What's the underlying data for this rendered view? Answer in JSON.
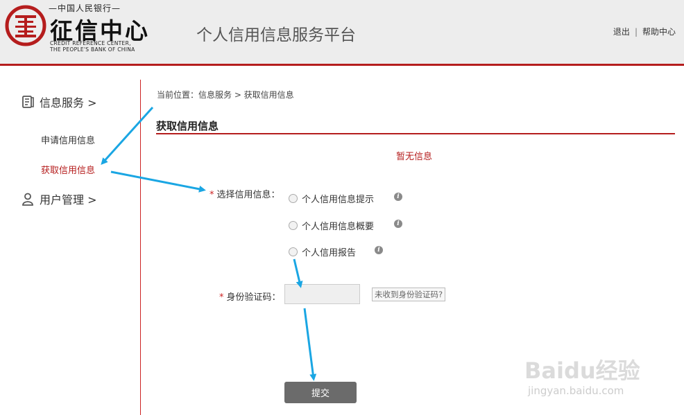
{
  "header": {
    "logo_top_text": "—中国人民银行—",
    "logo_main_text": "征信中心",
    "logo_en_line1": "CREDIT REFERENCE CENTER,",
    "logo_en_line2": "THE PEOPLE'S BANK OF CHINA",
    "platform_title": "个人信用信息服务平台",
    "logout_label": "退出",
    "link_separator": "|",
    "help_label": "帮助中心",
    "brand_color": "#b51d1d"
  },
  "sidebar": {
    "groups": [
      {
        "label": "信息服务 >",
        "icon": "document-icon"
      },
      {
        "label": "用户管理 >",
        "icon": "user-icon"
      }
    ],
    "items": [
      {
        "label": "申请信用信息",
        "active": false
      },
      {
        "label": "获取信用信息",
        "active": true
      }
    ]
  },
  "main": {
    "breadcrumb": "当前位置：信息服务 > 获取信用信息",
    "section_title": "获取信用信息",
    "notice": "暂无信息",
    "required_mark": "*",
    "select_label": "选择信用信息：",
    "options": [
      {
        "label": "个人信用信息提示",
        "info_icon": "info-icon"
      },
      {
        "label": "个人信用信息概要",
        "info_icon": "info-icon"
      },
      {
        "label": "个人信用报告",
        "info_icon": "info-icon"
      }
    ],
    "code_label": "身份验证码：",
    "code_value": "",
    "resend_label": "未收到身份验证码?",
    "submit_label": "提交"
  },
  "watermark": {
    "main": "Baidu经验",
    "sub": "jingyan.baidu.com"
  }
}
